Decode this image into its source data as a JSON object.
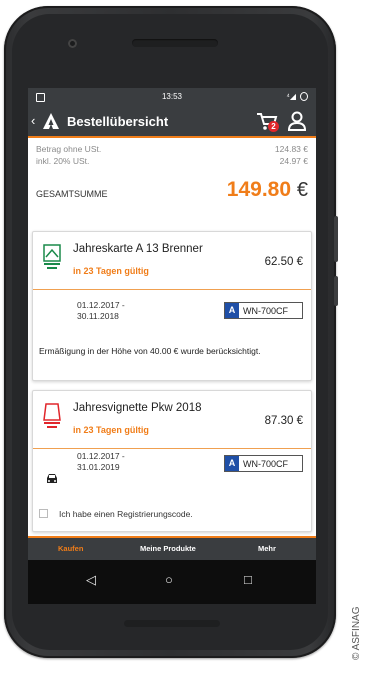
{
  "status_bar": {
    "time": "13:53",
    "signal": "⁴◢"
  },
  "app_bar": {
    "back": "‹",
    "title": "Bestellübersicht",
    "cart_count": "2"
  },
  "summary": {
    "net_label": "Betrag ohne USt.",
    "net_value": "124.83 €",
    "vat_label": "inkl. 20% USt.",
    "vat_value": "24.97 €",
    "total_label": "GESAMTSUMME",
    "total_value": "149.80",
    "total_currency": "€"
  },
  "products": [
    {
      "name": "Jahreskarte A 13 Brenner",
      "validity": "in 23 Tagen gültig",
      "price": "62.50 €",
      "date_from": "01.12.2017 -",
      "date_to": "30.11.2018",
      "plate_country": "A",
      "plate": "WN-700CF",
      "note": "Ermäßigung in der Höhe von 40.00 € wurde berücksichtigt."
    },
    {
      "name": "Jahresvignette Pkw 2018",
      "validity": "in 23 Tagen gültig",
      "price": "87.30 €",
      "date_from": "01.12.2017 -",
      "date_to": "31.01.2019",
      "plate_country": "A",
      "plate": "WN-700CF",
      "registration_label": "Ich habe einen Registrierungscode."
    }
  ],
  "bottom_nav": {
    "tab1": "Kaufen",
    "tab2": "Meine Produkte",
    "tab3": "Mehr"
  },
  "system_nav": {
    "back": "◁",
    "home": "○",
    "recents": "□"
  },
  "credit": "© ASFINAG",
  "colors": {
    "accent": "#f07d19",
    "appbar": "#3a3d40",
    "badge": "#e1262b",
    "plate_blue": "#1f4fa7"
  }
}
